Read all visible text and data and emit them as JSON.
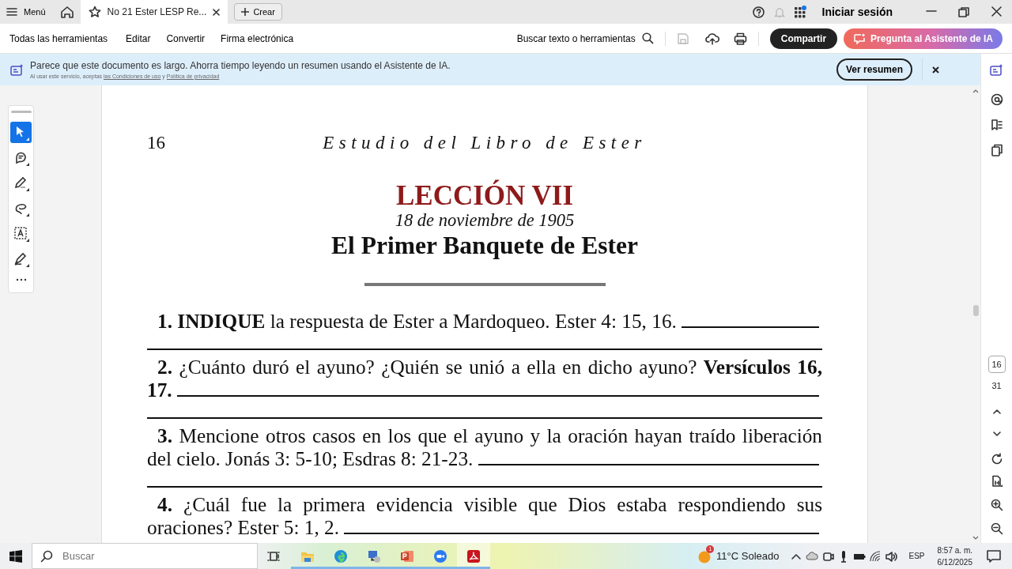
{
  "titlebar": {
    "menu_label": "Menú",
    "tab": {
      "title": "No 21 Ester LESP Re...",
      "selected": true
    },
    "create_label": "Crear",
    "sign_in": "Iniciar sesión"
  },
  "toolbar": {
    "items": [
      "Todas las herramientas",
      "Editar",
      "Convertir",
      "Firma electrónica"
    ],
    "search_label": "Buscar texto o herramientas",
    "share_label": "Compartir",
    "ai_label": "Pregunta al Asistente de IA"
  },
  "banner": {
    "message": "Parece que este documento es largo. Ahorra tiempo leyendo un resumen usando el Asistente de IA.",
    "legal_prefix": "Al usar este servicio, aceptas",
    "terms_link": "las Condiciones de uso",
    "conjunction": "y",
    "privacy_link": "Política de privacidad",
    "button": "Ver resumen"
  },
  "left_tools": [
    {
      "selected": true
    },
    {
      "selected": false
    },
    {
      "selected": false
    },
    {
      "selected": false
    },
    {
      "selected": false
    },
    {
      "selected": false
    }
  ],
  "document": {
    "page_number": "16",
    "running_head": "Estudio del Libro de Ester",
    "lesson": "LECCIÓN VII",
    "date": "18 de noviembre de 1905",
    "title": "El Primer Banquete de Ester",
    "questions": [
      {
        "text": "**1. INDIQUE** la respuesta de Ester a Mardoqueo. Ester 4: 15, 16."
      },
      {
        "text": "**2.** ¿Cuánto duró el ayuno? ¿Quién se unió a ella en dicho ayuno? **Versículos 16, 17.**"
      },
      {
        "text": "**3.** Mencione otros casos en los que el ayuno y la oración hayan traído liberación del cielo. Jonás 3: 5-10; Esdras 8: 21-23."
      },
      {
        "text": "**4.** ¿Cuál fue la primera evidencia visible que Dios estaba respondiendo sus oraciones? Ester 5: 1, 2."
      }
    ]
  },
  "page_nav": {
    "current": "16",
    "total": "31"
  },
  "taskbar": {
    "search_placeholder": "Buscar",
    "weather_badge": "1",
    "weather": "11°C Soleado",
    "language": "ESP",
    "time": "8:57 a. m.",
    "date": "6/12/2025"
  }
}
